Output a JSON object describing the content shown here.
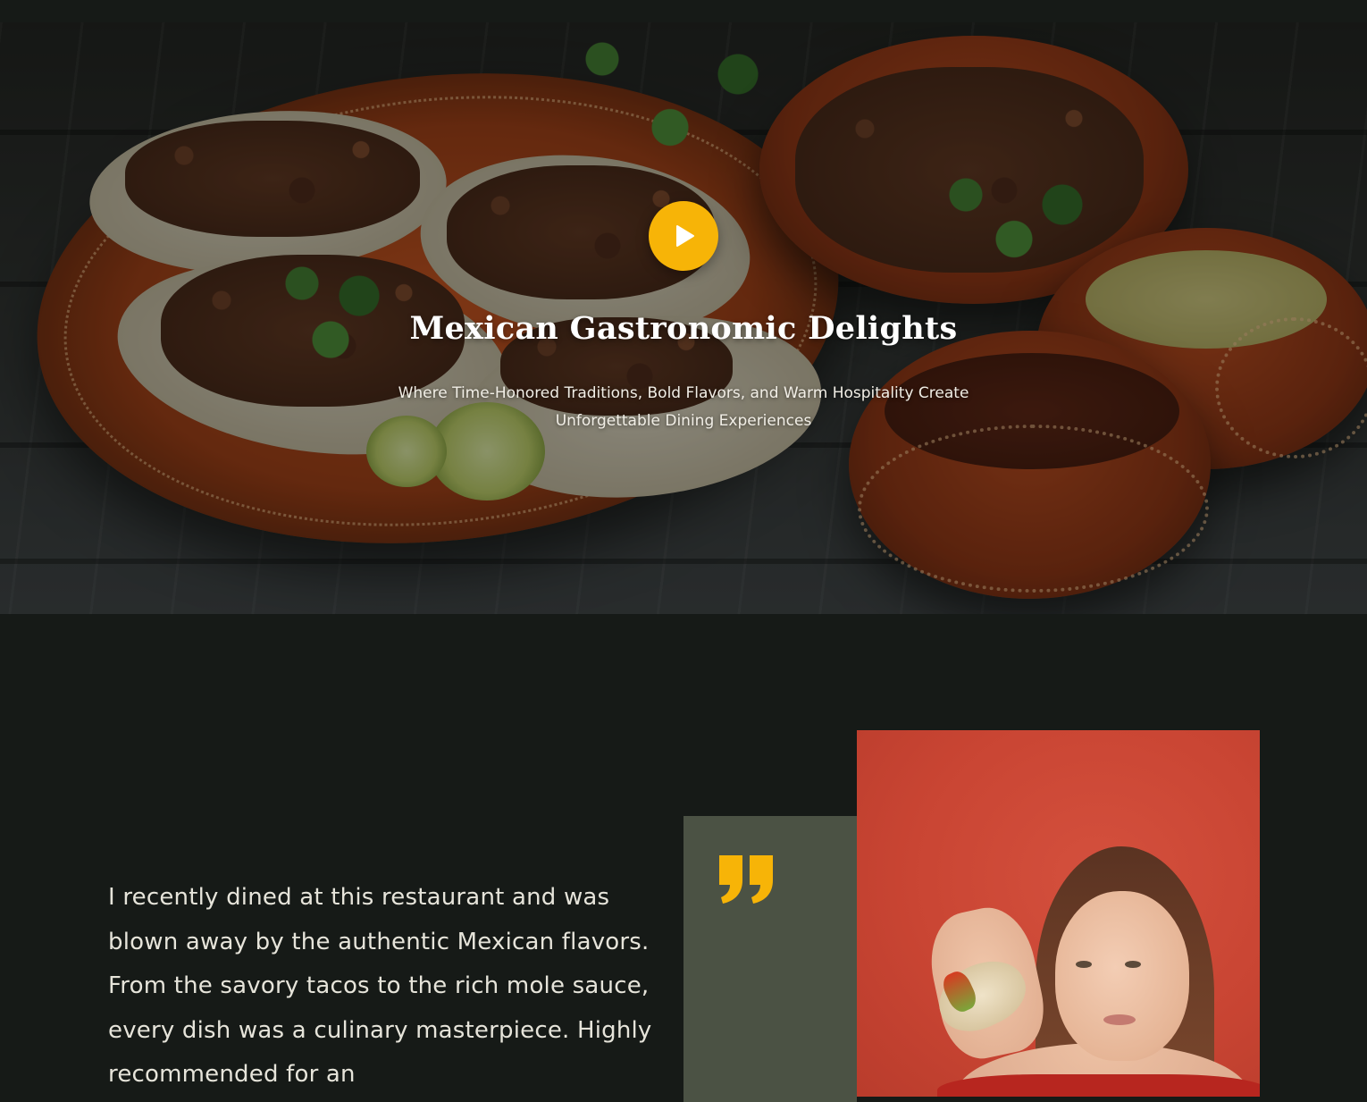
{
  "hero": {
    "title": "Mexican Gastronomic Delights",
    "subtitle": "Where Time-Honored Traditions, Bold Flavors, and Warm Hospitality Create Unforgettable Dining Experiences",
    "play_icon": "play-icon",
    "accent_color": "#f7b407"
  },
  "testimonial": {
    "text": "I recently dined at this restaurant and was blown away by the authentic Mexican flavors. From the savory tacos to the rich mole sauce, every dish was a culinary masterpiece. Highly recommended for an",
    "quote_icon": "quote-icon",
    "quote_color": "#f7b407",
    "panel_color": "#4b5244",
    "photo_bg_color": "#c94533"
  },
  "colors": {
    "page_bg": "#161a17"
  }
}
